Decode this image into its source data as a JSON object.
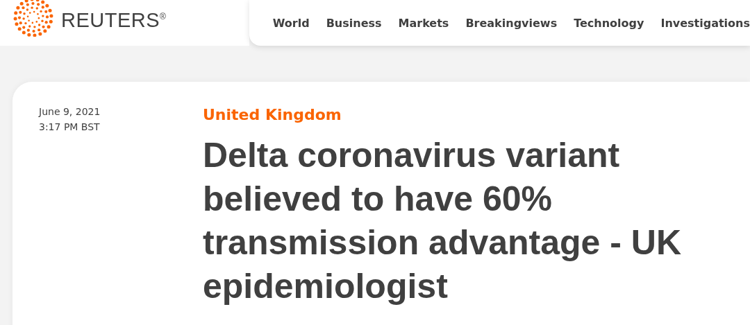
{
  "logo": {
    "wordmark": "REUTERS$^{®}$"
  },
  "nav": [
    {
      "label": "World"
    },
    {
      "label": "Business"
    },
    {
      "label": "Markets"
    },
    {
      "label": "Breakingviews"
    },
    {
      "label": "Technology"
    },
    {
      "label": "Investigations"
    }
  ],
  "article": {
    "date": "June 9, 2021",
    "time": "3:17 PM BST",
    "category": "United Kingdom",
    "headline": "Delta coronavirus variant believed to have 60% transmission advantage - UK epidemiologist"
  }
}
